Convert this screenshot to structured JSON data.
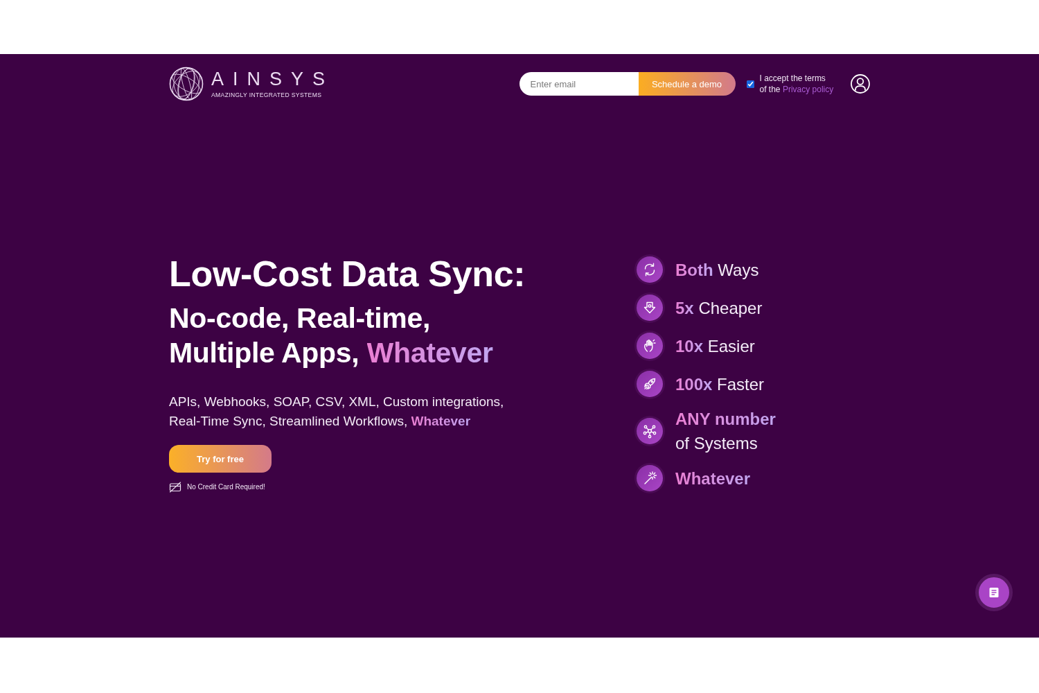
{
  "header": {
    "logo": {
      "wordmark": "AINSYS",
      "tagline": "AMAZINGLY INTEGRATED SYSTEMS"
    },
    "email_field": {
      "placeholder": "Enter email"
    },
    "demo_button": "Schedule a demo",
    "terms": {
      "checked": true,
      "text": "I accept the terms of the",
      "link": "Privacy policy"
    }
  },
  "hero": {
    "title": "Low-Cost Data Sync:",
    "subtitle": {
      "text": "No-code, Real-time, Multiple Apps,",
      "accent": "Whatever"
    },
    "description": "APIs, Webhooks, SOAP, CSV, XML, Custom integrations, Real-Time Sync, Streamlined Workflows, **Whatever**",
    "cta_button": "Try for free",
    "note": "No Credit Card Required!"
  },
  "features": [
    {
      "accent": "Both",
      "text": "Ways"
    },
    {
      "accent": "5x",
      "text": "Cheaper"
    },
    {
      "accent": "10x",
      "text": "Easier"
    },
    {
      "accent": "100x",
      "text": "Faster"
    },
    {
      "accent": "ANY number",
      "text": "of Systems"
    },
    {
      "accent": "Whatever"
    }
  ]
}
